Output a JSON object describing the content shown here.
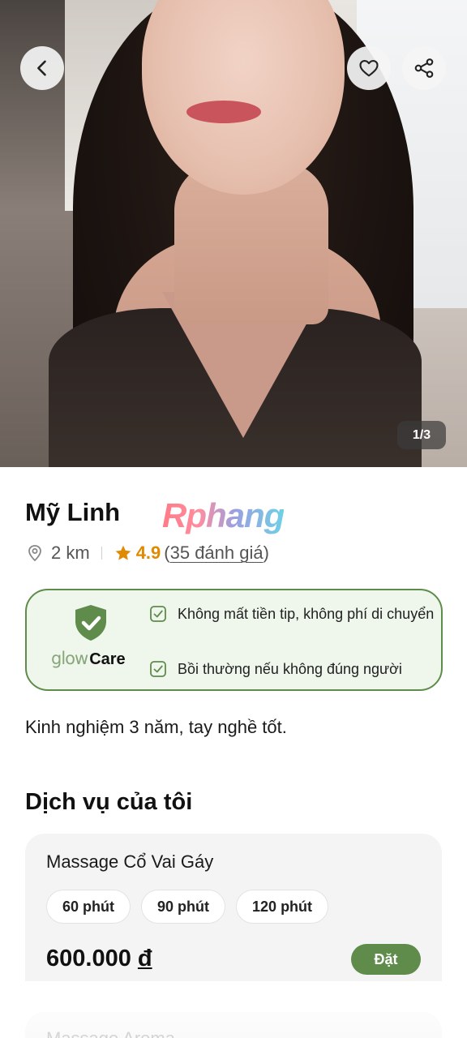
{
  "hero": {
    "photo_counter": "1/3",
    "back_icon": "chevron-left-icon",
    "favorite_icon": "heart-outline-icon",
    "share_icon": "share-icon"
  },
  "profile": {
    "name": "Mỹ Linh",
    "watermark": "Rphang",
    "distance": "2 km",
    "rating": "4.9",
    "reviews_open": "(",
    "reviews_text": "35 đánh giá",
    "reviews_close": ")",
    "rating_color": "#e08a00"
  },
  "care": {
    "brand_glow": "glow",
    "brand_care": "Care",
    "items": [
      "Không mất tiền tip, không phí di chuyển",
      "Bồi thường nếu không đúng người"
    ],
    "accent_color": "#5f8b4b"
  },
  "experience": "Kinh nghiệm 3 năm, tay nghề tốt.",
  "services_title": "Dịch vụ của tôi",
  "services": [
    {
      "name": "Massage Cổ Vai Gáy",
      "durations": [
        "60 phút",
        "90 phút",
        "120 phút"
      ],
      "price": "600.000",
      "currency": "đ",
      "book_label": "Đặt"
    },
    {
      "name": "Massage Aroma"
    }
  ]
}
